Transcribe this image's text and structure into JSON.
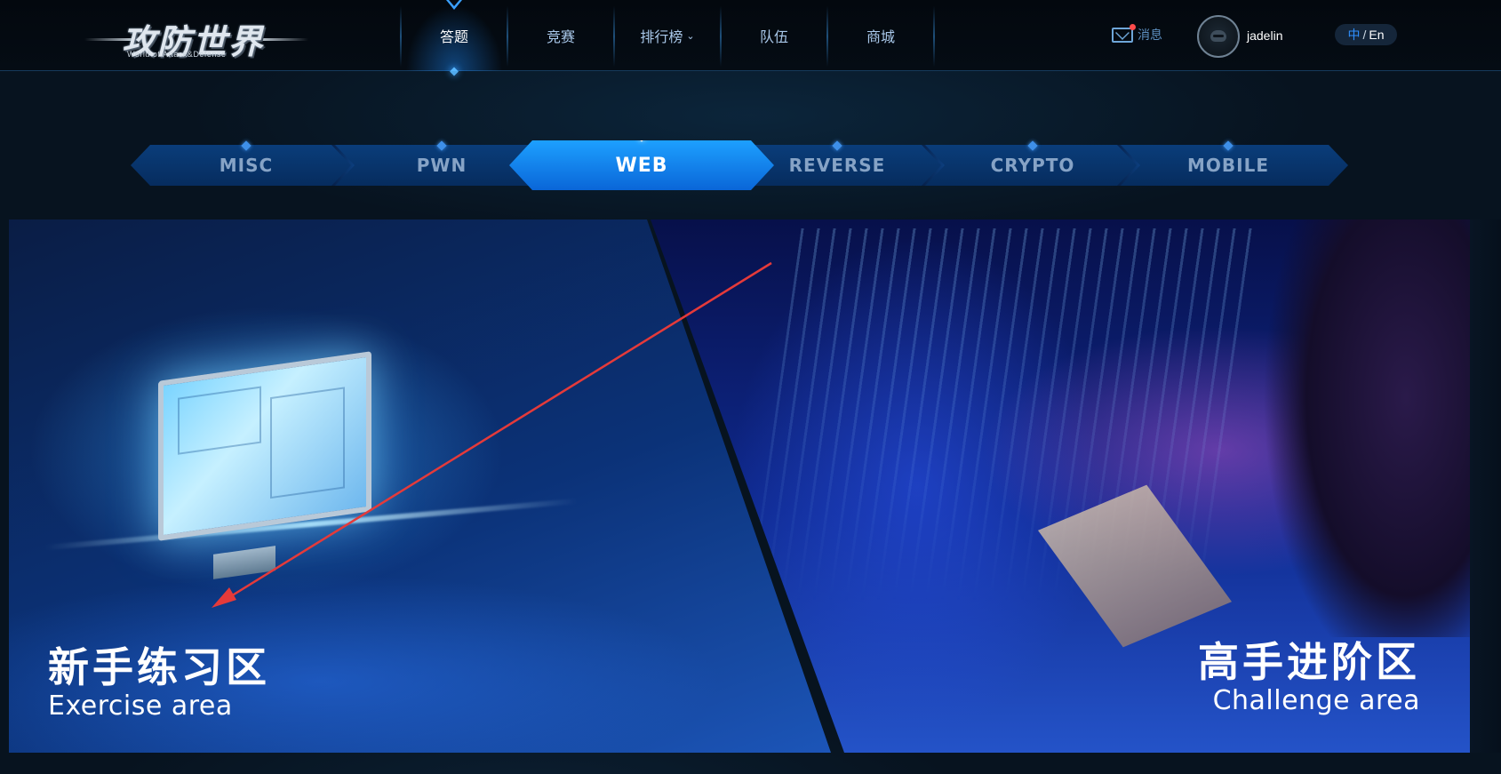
{
  "header": {
    "logo_cn": "攻防世界",
    "logo_en": "World of Attack&Defense",
    "nav": [
      {
        "label": "答题",
        "active": true
      },
      {
        "label": "竞赛",
        "active": false
      },
      {
        "label": "排行榜",
        "active": false,
        "dropdown": true
      },
      {
        "label": "队伍",
        "active": false
      },
      {
        "label": "商城",
        "active": false
      }
    ],
    "messages_label": "消息",
    "username": "jadelin",
    "lang": {
      "zh": "中",
      "sep": "/",
      "en": "En"
    }
  },
  "categories": [
    {
      "label": "MISC",
      "active": false
    },
    {
      "label": "PWN",
      "active": false
    },
    {
      "label": "WEB",
      "active": true
    },
    {
      "label": "REVERSE",
      "active": false
    },
    {
      "label": "CRYPTO",
      "active": false
    },
    {
      "label": "MOBILE",
      "active": false
    }
  ],
  "panels": {
    "exercise": {
      "title_cn": "新手练习区",
      "title_en": "Exercise area"
    },
    "challenge": {
      "title_cn": "高手进阶区",
      "title_en": "Challenge area"
    }
  },
  "icons": {
    "mail": "mail-icon",
    "avatar": "avatar-icon",
    "dropdown": "chevron-down-icon"
  },
  "colors": {
    "accent": "#1e8fff",
    "annotation_arrow": "#e53a3a",
    "unread_dot": "#ff4b4b"
  }
}
